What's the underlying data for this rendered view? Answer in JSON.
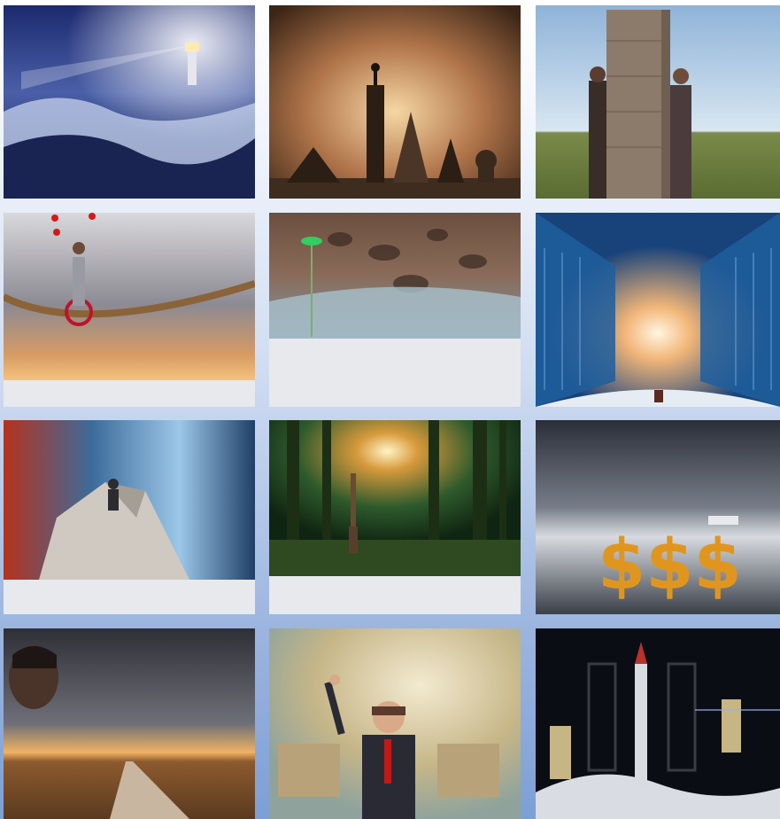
{
  "gallery": {
    "tiles": [
      {
        "subject": "lighthouse-storm",
        "caption": ""
      },
      {
        "subject": "chess-pieces-summit",
        "caption": ""
      },
      {
        "subject": "stone-wall-two-men",
        "caption": ""
      },
      {
        "subject": "unicycle-juggler-rope",
        "caption": ""
      },
      {
        "subject": "eroded-rock-sprout",
        "caption": ""
      },
      {
        "subject": "blue-corridor-light",
        "caption": ""
      },
      {
        "subject": "climber-boulder",
        "caption": ""
      },
      {
        "subject": "forest-light-figure",
        "caption": ""
      },
      {
        "subject": "dollar-signs-sea",
        "caption": ""
      },
      {
        "subject": "face-over-road",
        "caption": ""
      },
      {
        "subject": "boy-cardboard-jetpack",
        "caption": ""
      },
      {
        "subject": "rocket-launch-night",
        "caption": ""
      }
    ]
  },
  "colors": {
    "background_top": "#ffffff",
    "background_bottom": "#7d9fd6",
    "tile_caption_gray": "#e8e9ed"
  }
}
